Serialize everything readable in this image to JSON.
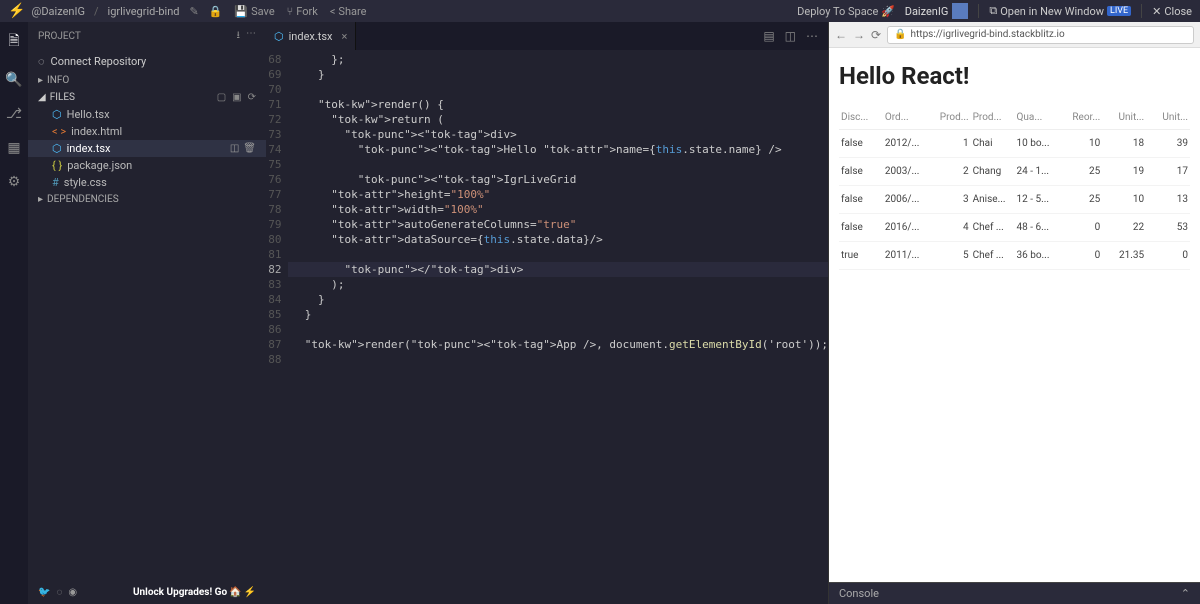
{
  "topbar": {
    "user": "@DaizenIG",
    "project": "igrlivegrid-bind",
    "save": "Save",
    "fork": "Fork",
    "share": "Share",
    "deploy": "Deploy To Space",
    "username": "DaizenIG",
    "open_new": "Open in New Window",
    "live": "LIVE",
    "close": "Close"
  },
  "sidebar": {
    "project": "PROJECT",
    "connect": "Connect Repository",
    "info": "INFO",
    "files": "FILES",
    "deps": "DEPENDENCIES",
    "items": [
      {
        "icon": "react",
        "label": "Hello.tsx",
        "selected": false
      },
      {
        "icon": "html",
        "label": "index.html",
        "selected": false
      },
      {
        "icon": "react",
        "label": "index.tsx",
        "selected": true
      },
      {
        "icon": "json",
        "label": "package.json",
        "selected": false
      },
      {
        "icon": "css",
        "label": "style.css",
        "selected": false
      }
    ],
    "upgrade": "Unlock Upgrades! Go"
  },
  "tab": {
    "label": "index.tsx"
  },
  "code": {
    "start": 68,
    "lines": [
      "      };",
      "    }",
      "",
      "    render() {",
      "      return (",
      "        <div>",
      "          <Hello name={this.state.name} />",
      "",
      "          <IgrLiveGrid",
      "      height=\"100%\"",
      "      width=\"100%\"",
      "      autoGenerateColumns=\"true\"",
      "      dataSource={this.state.data}/>",
      "",
      "        </div>",
      "      );",
      "    }",
      "  }",
      "",
      "  render(<App />, document.getElementById('root'));",
      ""
    ],
    "highlight_index": 14
  },
  "preview": {
    "url": "https://igrlivegrid-bind.stackblitz.io",
    "heading": "Hello React!",
    "columns": [
      "Disc...",
      "Ord...",
      "Prod...",
      "Prod...",
      "Qua...",
      "Reor...",
      "Unit...",
      "Unit..."
    ],
    "rows": [
      [
        "false",
        "2012/...",
        "1",
        "Chai",
        "10 bo...",
        "10",
        "18",
        "39"
      ],
      [
        "false",
        "2003/...",
        "2",
        "Chang",
        "24 - 1...",
        "25",
        "19",
        "17"
      ],
      [
        "false",
        "2006/...",
        "3",
        "Anise...",
        "12 - 5...",
        "25",
        "10",
        "13"
      ],
      [
        "false",
        "2016/...",
        "4",
        "Chef ...",
        "48 - 6...",
        "0",
        "22",
        "53"
      ],
      [
        "true",
        "2011/...",
        "5",
        "Chef ...",
        "36 bo...",
        "0",
        "21.35",
        "0"
      ]
    ],
    "console": "Console"
  }
}
